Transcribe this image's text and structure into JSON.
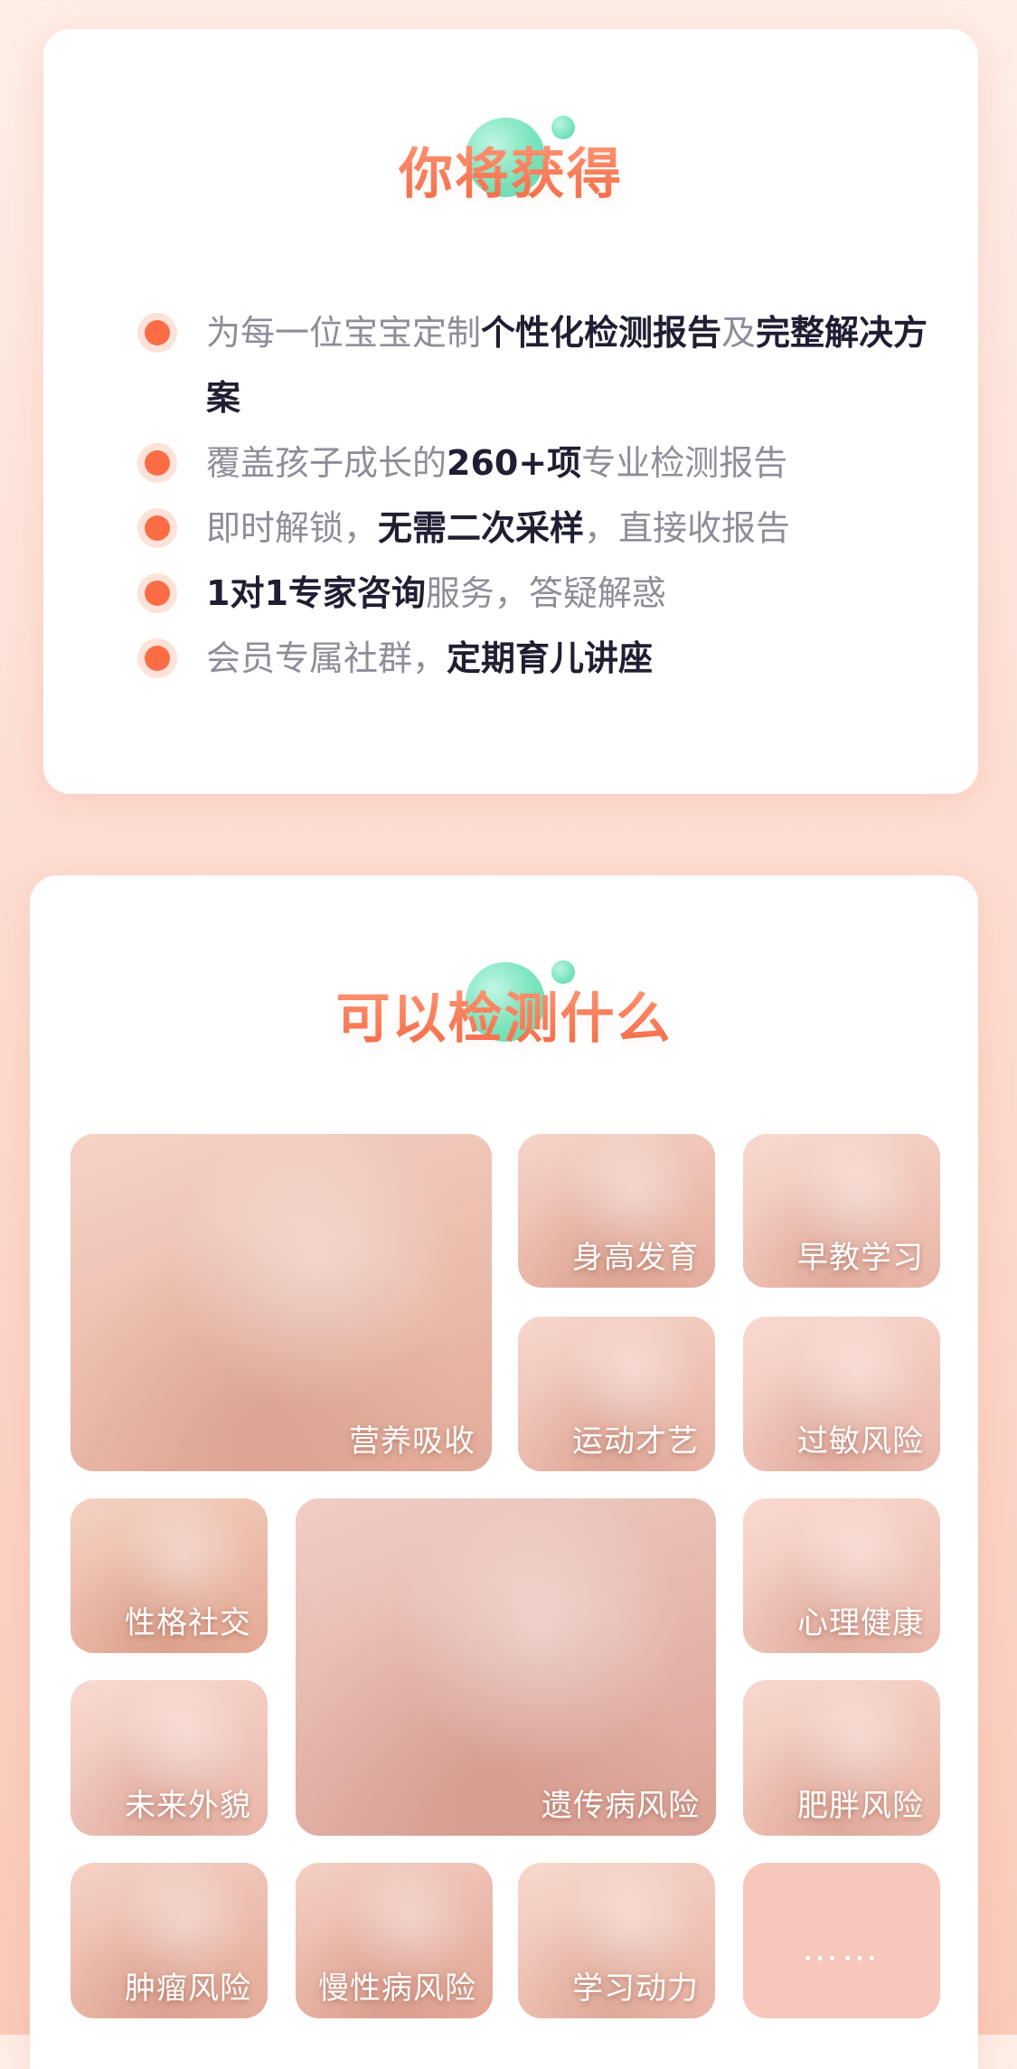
{
  "benefits": {
    "title": "你将获得",
    "items": [
      [
        {
          "t": "为每一位宝宝定制",
          "b": false
        },
        {
          "t": "个性化检测报告",
          "b": true
        },
        {
          "t": "及",
          "b": false
        },
        {
          "t": "完整解决方案",
          "b": true
        }
      ],
      [
        {
          "t": "覆盖孩子成长的",
          "b": false
        },
        {
          "t": "260+项",
          "b": true
        },
        {
          "t": "专业检测报告",
          "b": false
        }
      ],
      [
        {
          "t": "即时解锁，",
          "b": false
        },
        {
          "t": "无需二次采样",
          "b": true
        },
        {
          "t": "，直接收报告",
          "b": false
        }
      ],
      [
        {
          "t": "1对1专家咨询",
          "b": true
        },
        {
          "t": "服务，答疑解惑",
          "b": false
        }
      ],
      [
        {
          "t": "会员专属社群，",
          "b": false
        },
        {
          "t": "定期育儿讲座",
          "b": true
        }
      ]
    ]
  },
  "tests": {
    "title": "可以检测什么",
    "tiles": [
      {
        "label": "营养吸收",
        "photo": "boy-eating-salad",
        "color": "#e9b5a3"
      },
      {
        "label": "身高发育",
        "photo": "girl-measuring-height",
        "color": "#eab7a8"
      },
      {
        "label": "早教学习",
        "photo": "girl-book-on-head",
        "color": "#f0c3b6"
      },
      {
        "label": "运动才艺",
        "photo": "girl-dancing",
        "color": "#edbdb0"
      },
      {
        "label": "过敏风险",
        "photo": "sleeping-baby",
        "color": "#f2c6bb"
      },
      {
        "label": "性格社交",
        "photo": "smiling-girl",
        "color": "#e9b29c"
      },
      {
        "label": "遗传病风险",
        "photo": "sick-girl-resting",
        "color": "#dfa9a0"
      },
      {
        "label": "心理健康",
        "photo": "laughing-baby",
        "color": "#f2c6bb"
      },
      {
        "label": "未来外貌",
        "photo": "baby-portrait",
        "color": "#f0c4b9"
      },
      {
        "label": "肥胖风险",
        "photo": "sleeping-infant",
        "color": "#efc1b4"
      },
      {
        "label": "肿瘤风险",
        "photo": "girl-blowing-nose",
        "color": "#e9b3a2"
      },
      {
        "label": "慢性病风险",
        "photo": "toddler-covering-mouth",
        "color": "#e7ad9e"
      },
      {
        "label": "学习动力",
        "photo": "girl-with-glasses",
        "color": "#efc0b2"
      },
      {
        "label": "……",
        "photo": "more",
        "color": "#f6c7ba"
      }
    ]
  }
}
